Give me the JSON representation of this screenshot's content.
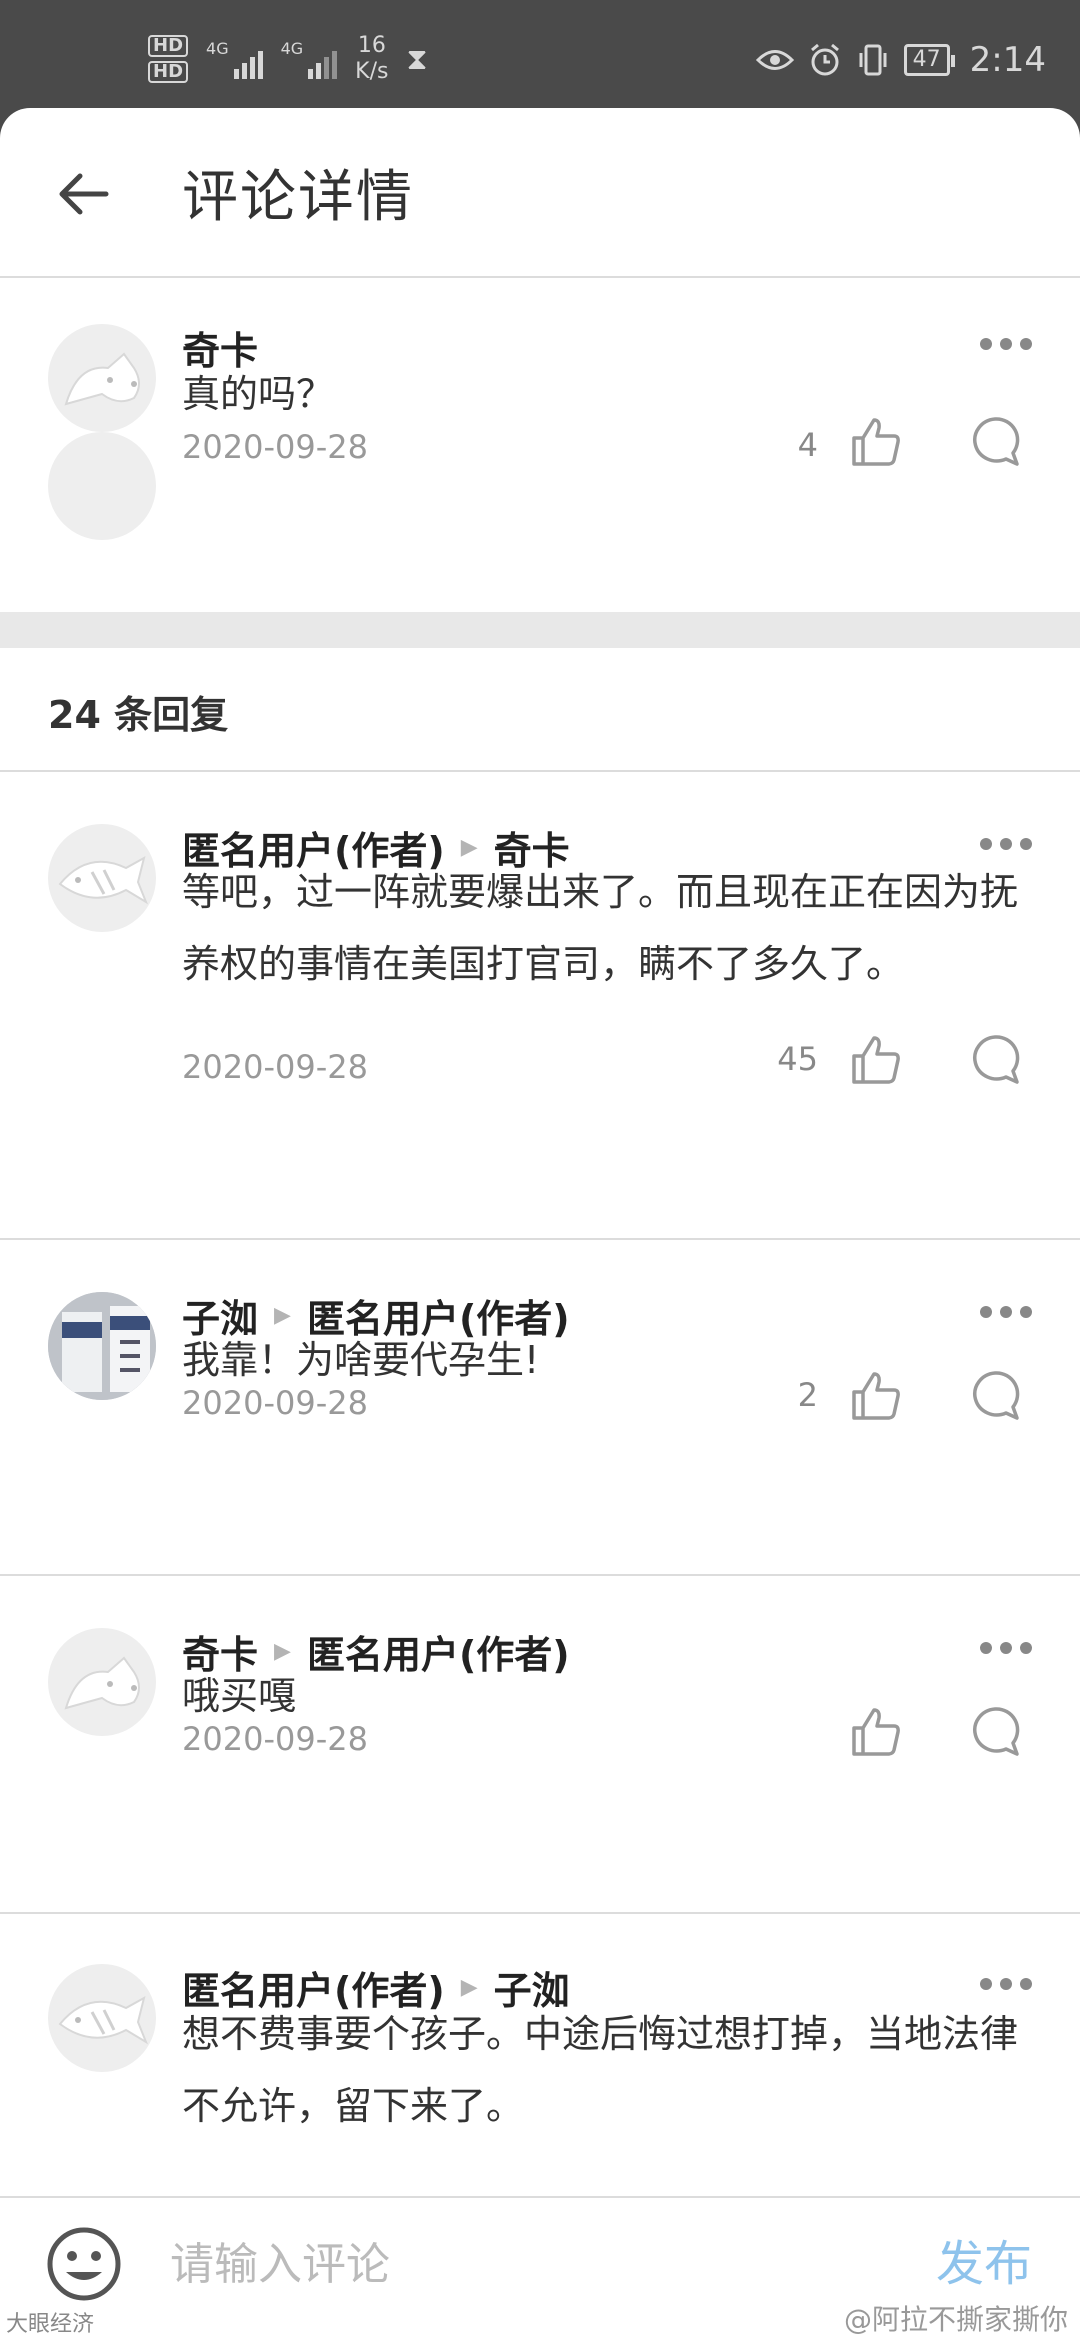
{
  "status_bar": {
    "hd1": "HD",
    "hd2": "HD",
    "net1": "4G",
    "net2": "4G",
    "speed_value": "16",
    "speed_unit": "K/s",
    "battery": "47",
    "time": "2:14"
  },
  "header": {
    "title": "评论详情"
  },
  "main_comment": {
    "author": "奇卡",
    "text": "真的吗？",
    "date": "2020-09-28",
    "likes": "4"
  },
  "replies_header": "24 条回复",
  "replies": [
    {
      "author": "匿名用户(作者)",
      "reply_to": "奇卡",
      "text": "等吧，过一阵就要爆出来了。而且现在正在因为抚养权的事情在美国打官司，瞒不了多久了。",
      "date": "2020-09-28",
      "likes": "45"
    },
    {
      "author": "子洳",
      "reply_to": "匿名用户(作者)",
      "text": "我靠！为啥要代孕生!",
      "date": "2020-09-28",
      "likes": "2"
    },
    {
      "author": "奇卡",
      "reply_to": "匿名用户(作者)",
      "text": "哦买嘎",
      "date": "2020-09-28",
      "likes": ""
    },
    {
      "author": "匿名用户(作者)",
      "reply_to": "子洳",
      "text": "想不费事要个孩子。中途后悔过想打掉，当地法律不允许，留下来了。",
      "date": "",
      "likes": ""
    }
  ],
  "input_bar": {
    "placeholder": "请输入评论",
    "send_label": "发布"
  },
  "watermarks": {
    "left": "大眼经济",
    "right": "@阿拉不撕家撕你"
  },
  "colors": {
    "send_accent": "#8ec3ec",
    "status_bar_bg": "#4a4a4a",
    "divider": "#dcdcdc"
  }
}
